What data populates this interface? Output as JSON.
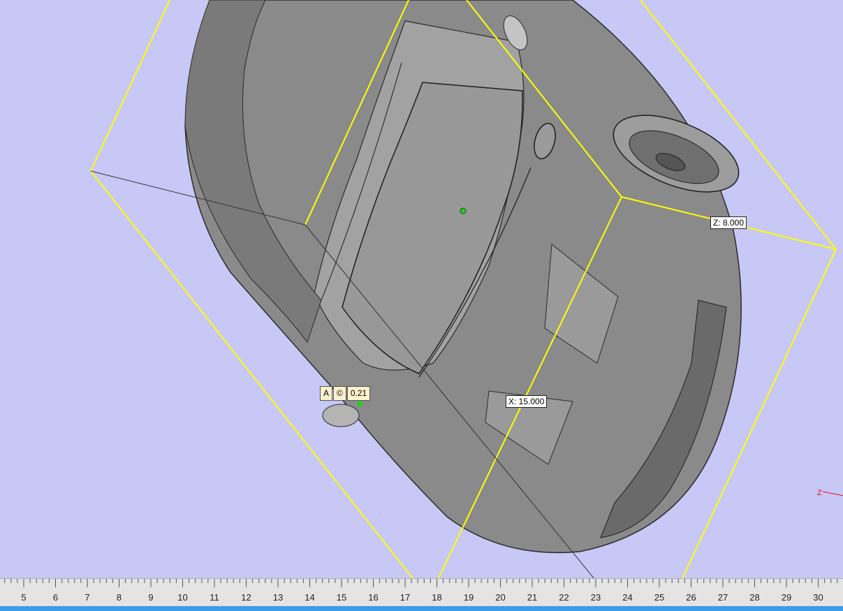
{
  "viewport": {
    "background_color": "#c8c8f7",
    "bounding_box_color": "#ffff00",
    "model_color": "#8a8a8a",
    "dimension_labels": {
      "x": "X: 15.000",
      "z": "Z: 8.000"
    },
    "tool_widget": {
      "mode": "A",
      "symbol": "©",
      "value": "0.21"
    },
    "axis_indicator": "Z"
  },
  "ruler": {
    "labels": [
      "5",
      "6",
      "7",
      "8",
      "9",
      "10",
      "11",
      "12",
      "13",
      "14",
      "15",
      "16",
      "17",
      "18",
      "19",
      "20",
      "21",
      "22",
      "23",
      "24",
      "25",
      "26",
      "27",
      "28",
      "29",
      "30"
    ]
  },
  "colors": {
    "status_strip": "#3d9be9",
    "ruler_bg": "#e4e4e4",
    "pivot_marker": "#22cc22"
  }
}
